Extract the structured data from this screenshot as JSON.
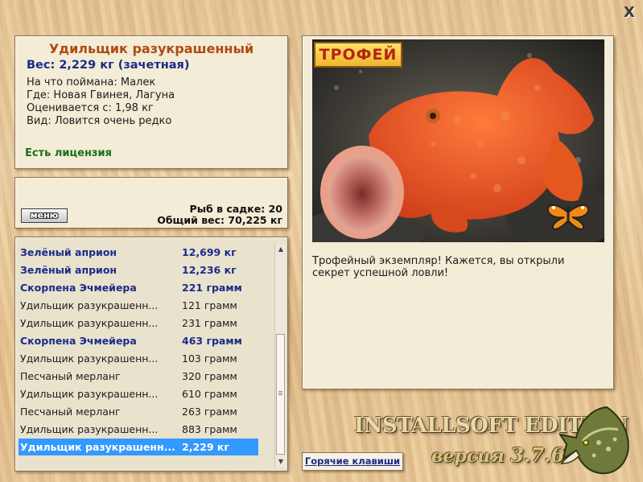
{
  "close_label": "X",
  "info": {
    "fish_name": "Удильщик разукрашенный",
    "weight": "Вес: 2,229 кг (зачетная)",
    "bait": "На что поймана: Малек",
    "location": "Где: Новая Гвинея, Лагуна",
    "min_value": "Оценивается с: 1,98 кг",
    "rarity": "Вид: Ловится очень редко",
    "license": "Есть лицензия"
  },
  "summary": {
    "menu_label": "меню",
    "fish_count": "Рыб в садке: 20",
    "total_weight": "Общий вес: 70,225 кг"
  },
  "catch_list": [
    {
      "name": "Зелёный априон",
      "weight": "12,699 кг"
    },
    {
      "name": "Зелёный априон",
      "weight": "12,236 кг"
    },
    {
      "name": "Скорпена Эчмейера",
      "weight": "221 грамм"
    },
    {
      "name": "Удильщик разукрашенн...",
      "weight": "121 грамм"
    },
    {
      "name": "Удильщик разукрашенн...",
      "weight": "231 грамм"
    },
    {
      "name": "Скорпена Эчмейера",
      "weight": "463 грамм"
    },
    {
      "name": "Удильщик разукрашенн...",
      "weight": "103 грамм"
    },
    {
      "name": "Песчаный мерланг",
      "weight": "320 грамм"
    },
    {
      "name": "Удильщик разукрашенн...",
      "weight": "610 грамм"
    },
    {
      "name": "Песчаный мерланг",
      "weight": "263 грамм"
    },
    {
      "name": "Удильщик разукрашенн...",
      "weight": "883 грамм"
    },
    {
      "name": "Удильщик разукрашенн...",
      "weight": "2,229 кг"
    }
  ],
  "viewer": {
    "badge": "ТРОФЕЙ",
    "description": "Трофейный экземпляр! Кажется, вы открыли секрет успешной ловли!"
  },
  "brand": {
    "edition": "INSTALLSOFT EDITION",
    "version_label": "версия",
    "version_number": "3.7.6"
  },
  "hotkeys_label": "Горячие клавиши",
  "colors": {
    "title": "#b24a14",
    "weight": "#1c2b88",
    "license": "#1b6e1b",
    "selection": "#3399ff"
  }
}
